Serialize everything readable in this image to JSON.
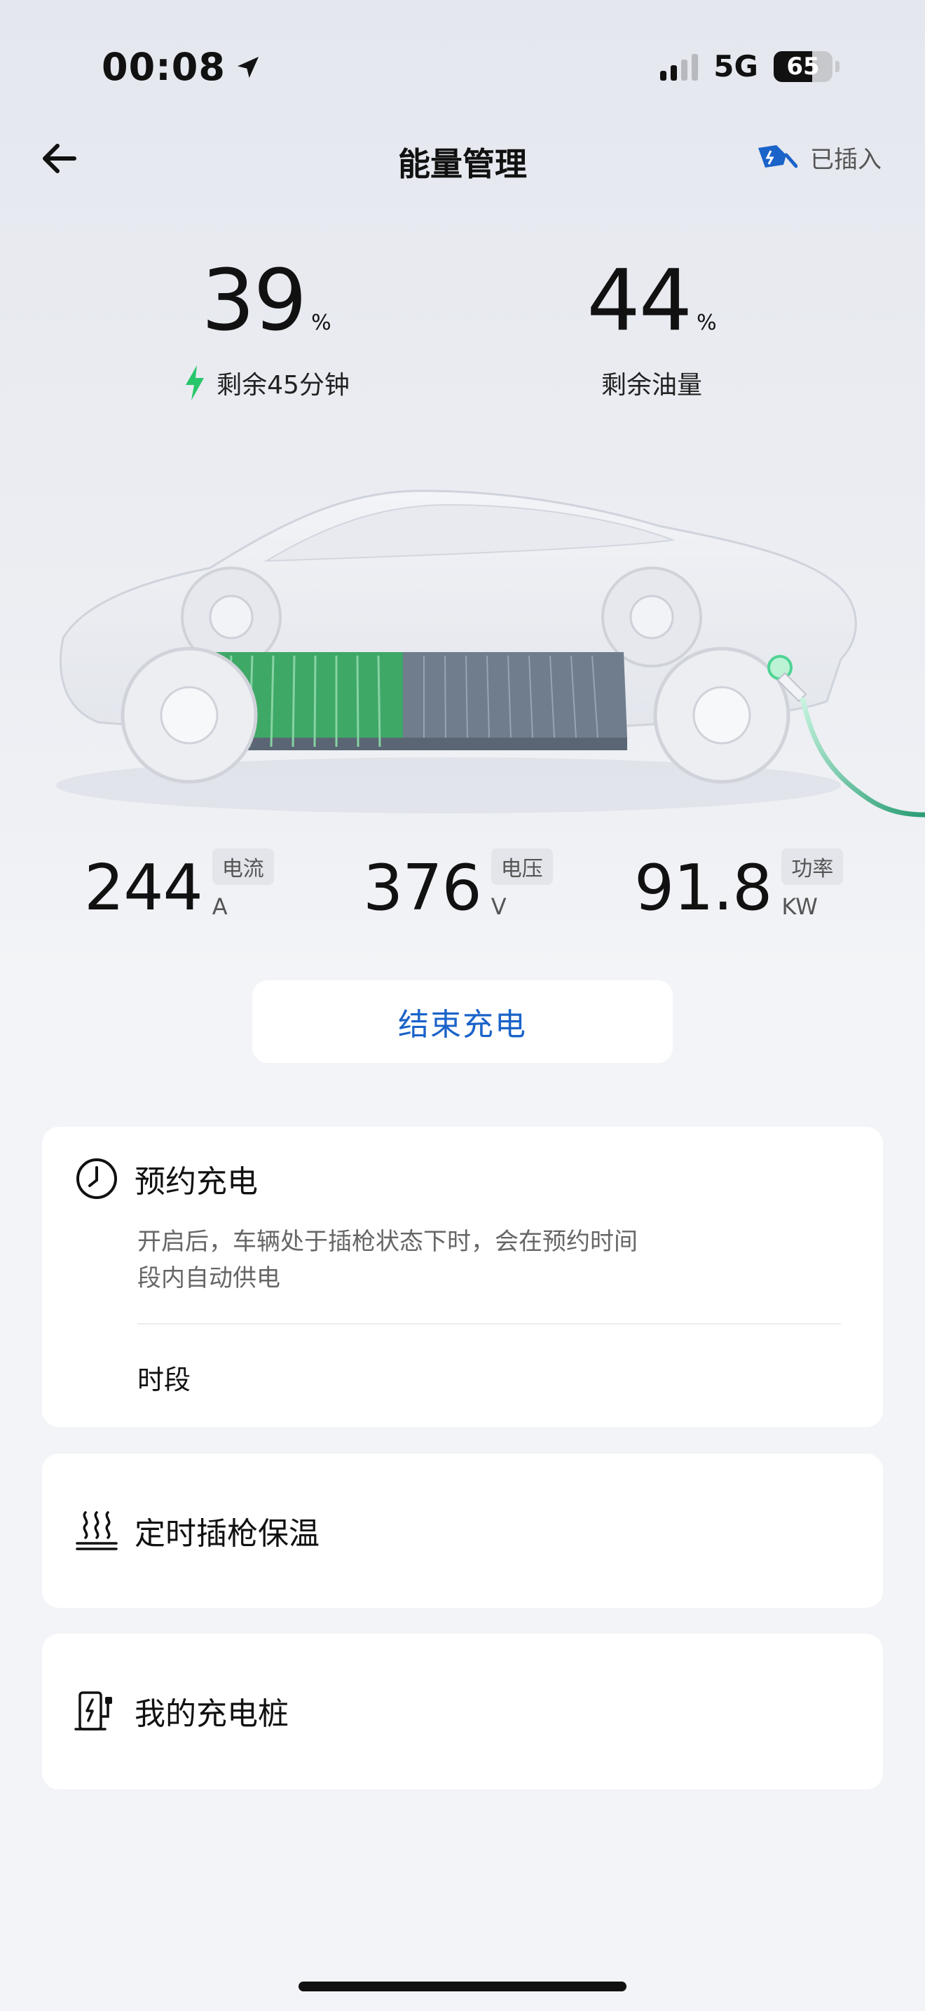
{
  "status_bar": {
    "time": "00:08",
    "network": "5G",
    "battery": "65"
  },
  "header": {
    "title": "能量管理",
    "plug_status": "已插入"
  },
  "energy": {
    "battery_percent": "39",
    "battery_unit": "%",
    "battery_sub": "剩余45分钟",
    "fuel_percent": "44",
    "fuel_unit": "%",
    "fuel_sub": "剩余油量"
  },
  "metrics": [
    {
      "value": "244",
      "tag": "电流",
      "unit": "A"
    },
    {
      "value": "376",
      "tag": "电压",
      "unit": "V"
    },
    {
      "value": "91.8",
      "tag": "功率",
      "unit": "KW"
    }
  ],
  "stop_button": "结束充电",
  "cards": {
    "schedule": {
      "title": "预约充电",
      "desc_line1": "开启后，车辆处于插枪状态下时，会在预约时间",
      "desc_line2": "段内自动供电",
      "slot_label": "时段"
    },
    "heating": {
      "title": "定时插枪保温"
    },
    "charger": {
      "title": "我的充电桩"
    }
  },
  "colors": {
    "accent": "#1a63c9",
    "charge_green": "#28c66a"
  }
}
